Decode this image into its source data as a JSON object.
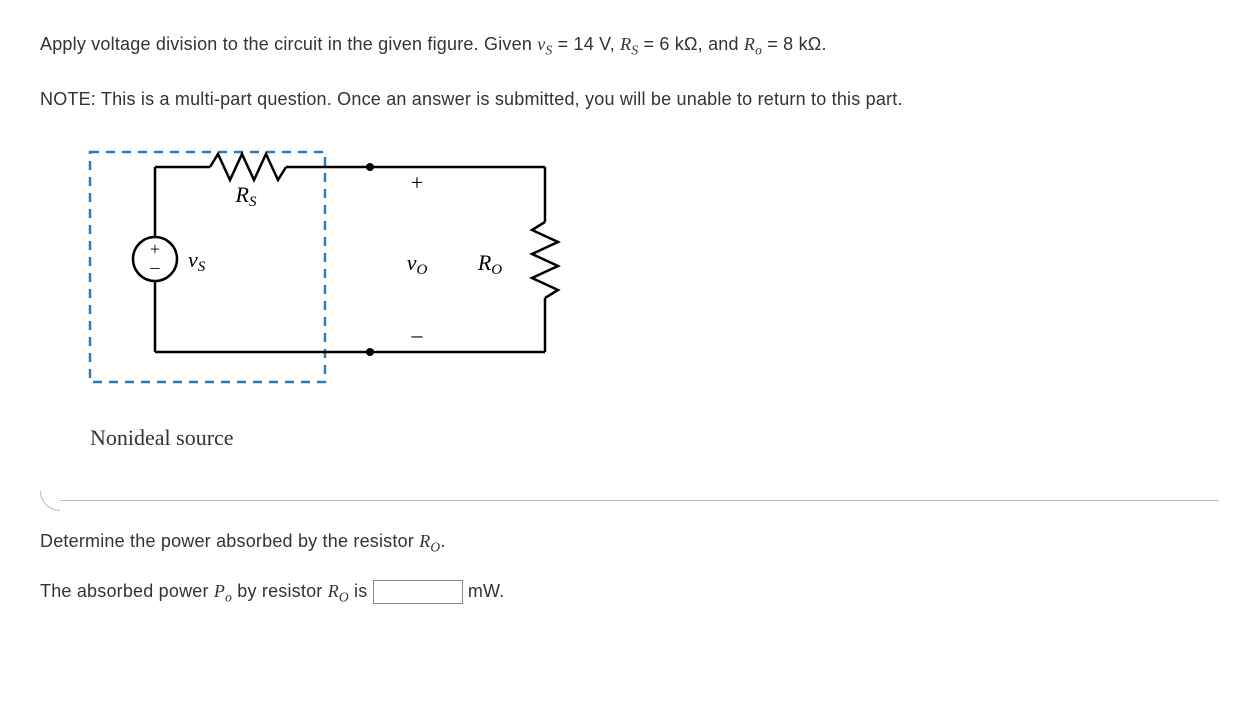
{
  "question": {
    "part1_before": "Apply voltage division to the circuit in the given figure. Given ",
    "vs_label": "v",
    "vs_sub": "S",
    "eq1": " = 14 V, ",
    "rs_label": "R",
    "rs_sub": "S",
    "eq2": " = 6 kΩ, and ",
    "ro_label": "R",
    "ro_sub": "o",
    "eq3": " = 8 kΩ."
  },
  "note": "NOTE: This is a multi-part question. Once an answer is submitted, you will be unable to return to this part.",
  "figure": {
    "rs_label": "R",
    "rs_sub": "S",
    "vs_label": "v",
    "vs_sub": "S",
    "plus": "+",
    "minus": "–",
    "vo_label": "v",
    "vo_sub": "O",
    "ro_label": "R",
    "ro_sub": "O",
    "caption": "Nonideal source"
  },
  "question_part": {
    "before": "Determine the power absorbed by the resistor ",
    "ro_label": "R",
    "ro_sub": "O",
    "after": "."
  },
  "answer": {
    "before": "The absorbed power ",
    "po_label": "P",
    "po_sub": "o",
    "mid": " by resistor ",
    "ro_label": "R",
    "ro_sub": "O",
    "after_input_unit": " mW.",
    "is_text": " is ",
    "input_value": ""
  }
}
